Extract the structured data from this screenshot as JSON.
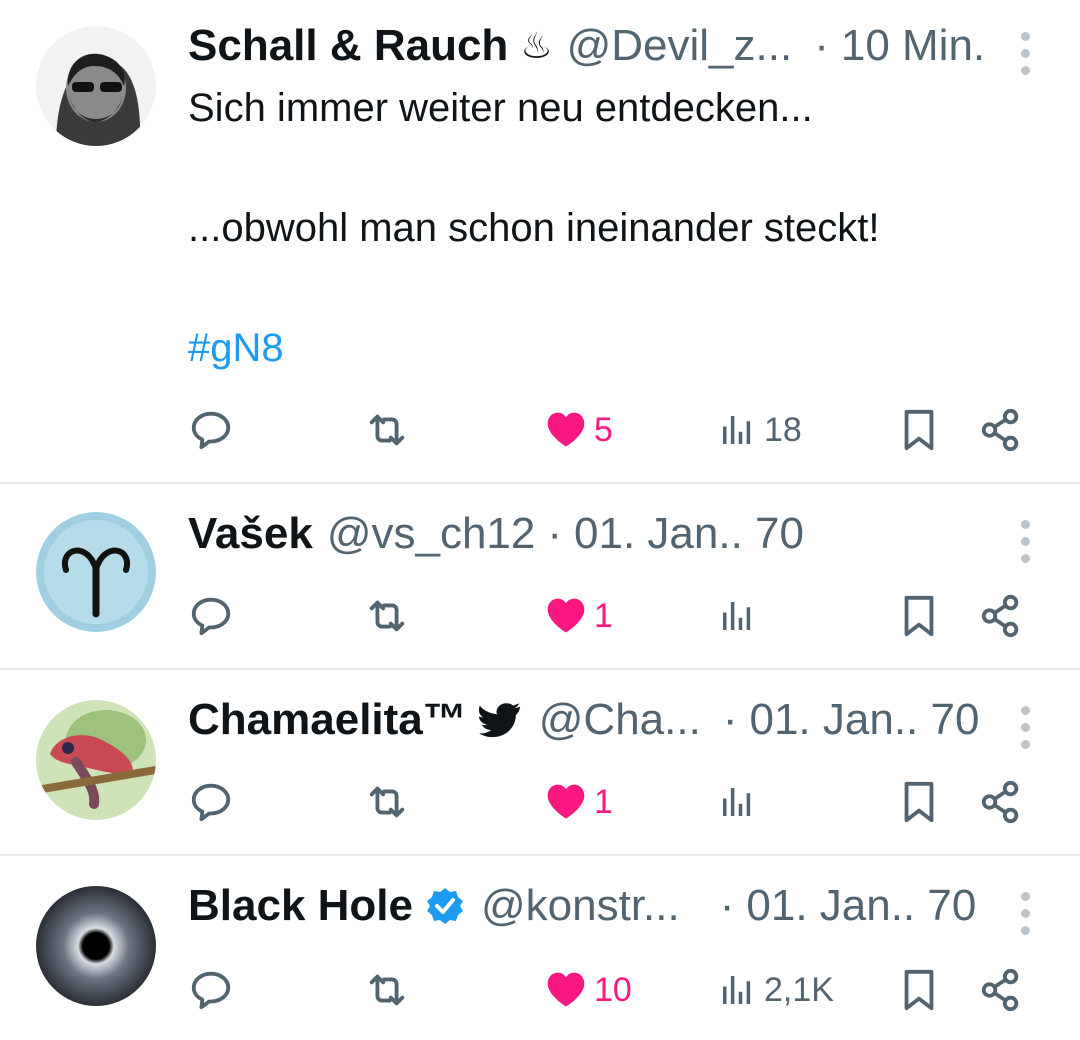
{
  "posts": [
    {
      "name": "Schall & Rauch",
      "badge": "♨",
      "handle": "@Devil_z...",
      "dot": "·",
      "time": "10 Min.",
      "lines": [
        "Sich immer weiter neu entdecken...",
        "...obwohl man schon ineinander steckt!",
        "#gN8"
      ],
      "likes": "5",
      "views": "18"
    },
    {
      "name": "Vašek",
      "handle": "@vs_ch12",
      "dot": "·",
      "time": "01. Jan.. 70",
      "likes": "1",
      "views": ""
    },
    {
      "name": "Chamaelita™",
      "handle": "@Cha...",
      "dot": "·",
      "time": "01. Jan.. 70",
      "likes": "1",
      "views": ""
    },
    {
      "name": "Black Hole",
      "handle": "@konstr...",
      "dot": "·",
      "time": "01. Jan.. 70",
      "likes": "10",
      "views": "2,1K"
    }
  ],
  "colors": {
    "like": "#f91880",
    "link": "#1d9bf0",
    "muted": "#536471",
    "verified": "#1d9bf0"
  }
}
